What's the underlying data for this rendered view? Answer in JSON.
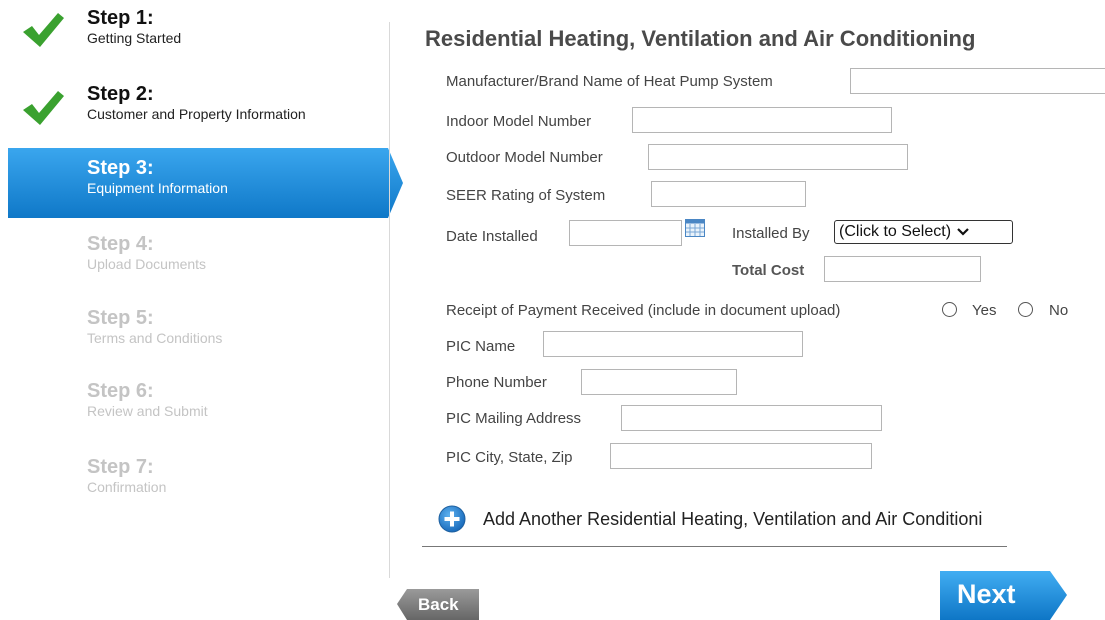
{
  "sidebar": {
    "steps": [
      {
        "title": "Step 1:",
        "subtitle": "Getting Started",
        "state": "done"
      },
      {
        "title": "Step 2:",
        "subtitle": "Customer and Property Information",
        "state": "done"
      },
      {
        "title": "Step 3:",
        "subtitle": "Equipment Information",
        "state": "active"
      },
      {
        "title": "Step 4:",
        "subtitle": "Upload Documents",
        "state": "todo"
      },
      {
        "title": "Step 5:",
        "subtitle": "Terms and Conditions",
        "state": "todo"
      },
      {
        "title": "Step 6:",
        "subtitle": "Review and Submit",
        "state": "todo"
      },
      {
        "title": "Step 7:",
        "subtitle": "Confirmation",
        "state": "todo"
      }
    ]
  },
  "form": {
    "title": "Residential Heating, Ventilation and Air Conditioning",
    "manufacturer_label": "Manufacturer/Brand Name of Heat Pump System",
    "manufacturer_value": "",
    "indoor_model_label": "Indoor Model Number",
    "indoor_model_value": "",
    "outdoor_model_label": "Outdoor Model Number",
    "outdoor_model_value": "",
    "seer_label": "SEER Rating of System",
    "seer_value": "",
    "date_installed_label": "Date Installed",
    "date_installed_value": "",
    "installed_by_label": "Installed By",
    "installed_by_selected": "(Click to Select)",
    "total_cost_label": "Total Cost",
    "total_cost_value": "",
    "receipt_label": "Receipt of Payment Received (include in document upload)",
    "receipt_yes": "Yes",
    "receipt_no": "No",
    "pic_name_label": "PIC Name",
    "pic_name_value": "",
    "phone_label": "Phone Number",
    "phone_value": "",
    "mailing_label": "PIC Mailing Address",
    "mailing_value": "",
    "city_label": "PIC City, State, Zip",
    "city_value": "",
    "add_another_label": "Add Another Residential Heating, Ventilation and Air Conditioni"
  },
  "nav": {
    "back_label": "Back",
    "next_label": "Next"
  },
  "colors": {
    "accent_blue": "#1e88d6",
    "check_green": "#3aa12f",
    "back_gray": "#7b7b7b"
  },
  "icons": {
    "done": "check-icon",
    "calendar": "calendar-icon",
    "add": "plus-circle-icon",
    "select": "chevron-down-icon"
  }
}
